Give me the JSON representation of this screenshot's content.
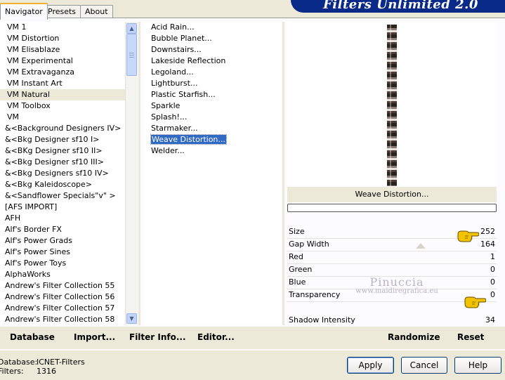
{
  "window": {
    "title": "Filters Unlimited 2.0"
  },
  "tabs": [
    {
      "label": "Navigator",
      "active": true
    },
    {
      "label": "Presets",
      "active": false
    },
    {
      "label": "About",
      "active": false
    }
  ],
  "categories": [
    "VM 1",
    "VM Distortion",
    "VM Elisablaze",
    "VM Experimental",
    "VM Extravaganza",
    "VM Instant Art",
    "VM Natural",
    "VM Toolbox",
    "VM",
    "&<Background Designers IV>",
    "&<Bkg Designer sf10 I>",
    "&<BKg Designer sf10 II>",
    "&<Bkg Designer sf10 III>",
    "&<Bkg Designers sf10 IV>",
    "&<Bkg Kaleidoscope>",
    "&<Sandflower Specials\"v\" >",
    "[AFS IMPORT]",
    "AFH",
    "Alf's Border FX",
    "Alf's Power Grads",
    "Alf's Power Sines",
    "Alf's Power Toys",
    "AlphaWorks",
    "Andrew's Filter Collection 55",
    "Andrew's Filter Collection 56",
    "Andrew's Filter Collection 57",
    "Andrew's Filter Collection 58"
  ],
  "selected_category": "VM Natural",
  "filters": [
    "Acid Rain...",
    "Bubble Planet...",
    "Downstairs...",
    "Lakeside Reflection",
    "Legoland...",
    "Lightburst...",
    "Plastic Starfish...",
    "Sparkle",
    "Splash!...",
    "Starmaker...",
    "Weave Distortion...",
    "Welder..."
  ],
  "selected_filter": "Weave Distortion...",
  "preview": {
    "caption": "Weave Distortion..."
  },
  "params": [
    {
      "name": "Size",
      "value": "252"
    },
    {
      "name": "Gap Width",
      "value": "164"
    },
    {
      "name": "Red",
      "value": "1"
    },
    {
      "name": "Green",
      "value": "0"
    },
    {
      "name": "Blue",
      "value": "0"
    },
    {
      "name": "Transparency",
      "value": "0"
    },
    {
      "name": "Shadow Intensity",
      "value": "34"
    }
  ],
  "watermark": {
    "line1": "Pinuccia",
    "line2": "www.maidiregrafica.eu"
  },
  "toolbar": {
    "database": "Database",
    "import": "Import...",
    "filter_info": "Filter Info...",
    "editor": "Editor...",
    "randomize": "Randomize",
    "reset": "Reset"
  },
  "status": {
    "database_label": "Database:",
    "database_value": "ICNET-Filters",
    "filters_label": "Filters:",
    "filters_value": "1316"
  },
  "buttons": {
    "apply": "Apply",
    "cancel": "Cancel",
    "help": "Help"
  },
  "colors": {
    "selection": "#316ac5",
    "banner": "#0a2a8a",
    "dialog_bg": "#ece9d8"
  }
}
